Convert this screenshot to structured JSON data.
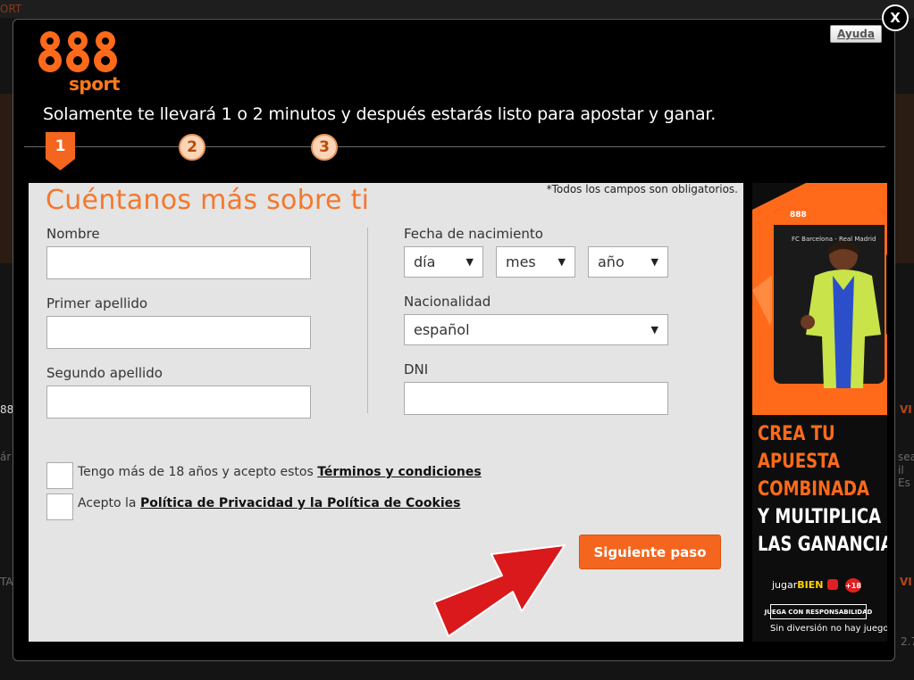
{
  "background": {
    "top_left_text": "ORT",
    "left_fragment_1": "88",
    "left_fragment_2": "ár",
    "left_fragment_3": "TA",
    "right_fragment_1": "VI",
    "right_fragment_2": "sea",
    "right_fragment_3": "il Es",
    "right_fragment_4": "VI",
    "right_fragment_5": "2.7"
  },
  "modal": {
    "close_label": "X",
    "help_label": "Ayuda",
    "logo_numbers": "888",
    "logo_sport": "sport",
    "tagline": "Solamente te llevará 1 o 2 minutos y después estarás listo para apostar y ganar.",
    "steps": [
      {
        "label": "1",
        "active": true
      },
      {
        "label": "2",
        "active": false
      },
      {
        "label": "3",
        "active": false
      }
    ]
  },
  "form": {
    "title": "Cuéntanos más sobre ti",
    "required_note": "*Todos los campos son obligatorios.",
    "nombre_label": "Nombre",
    "nombre_value": "",
    "primer_apellido_label": "Primer apellido",
    "primer_apellido_value": "",
    "segundo_apellido_label": "Segundo apellido",
    "segundo_apellido_value": "",
    "fecha_label": "Fecha de nacimiento",
    "dia_value": "día",
    "mes_value": "mes",
    "ano_value": "año",
    "nacionalidad_label": "Nacionalidad",
    "nacionalidad_value": "español",
    "dni_label": "DNI",
    "dni_value": "",
    "terms_text": "Tengo más de 18 años y acepto estos ",
    "terms_link": "Términos y condiciones",
    "privacy_text": "Acepto la ",
    "privacy_link": "Política de Privacidad y la Política de Cookies",
    "next_button": "Siguiente paso"
  },
  "promo": {
    "phone_brand": "888",
    "phone_match": "FC Barcelona - Real Madrid",
    "headline_1": "CREA TU",
    "headline_2": "APUESTA",
    "headline_3": "COMBINADA",
    "headline_4": "Y MULTIPLICA",
    "headline_5": "LAS GANANCIAS",
    "jugar_prefix": "jugar",
    "jugar_bold": "BIEN",
    "age_badge": "+18",
    "responsible": "JUEGA CON RESPONSABILIDAD",
    "fun_note": "Sin diversión no hay juego"
  },
  "colors": {
    "accent": "#f4651e",
    "title_orange": "#f4782c",
    "panel_bg": "#e4e4e4",
    "modal_bg": "#000000"
  }
}
